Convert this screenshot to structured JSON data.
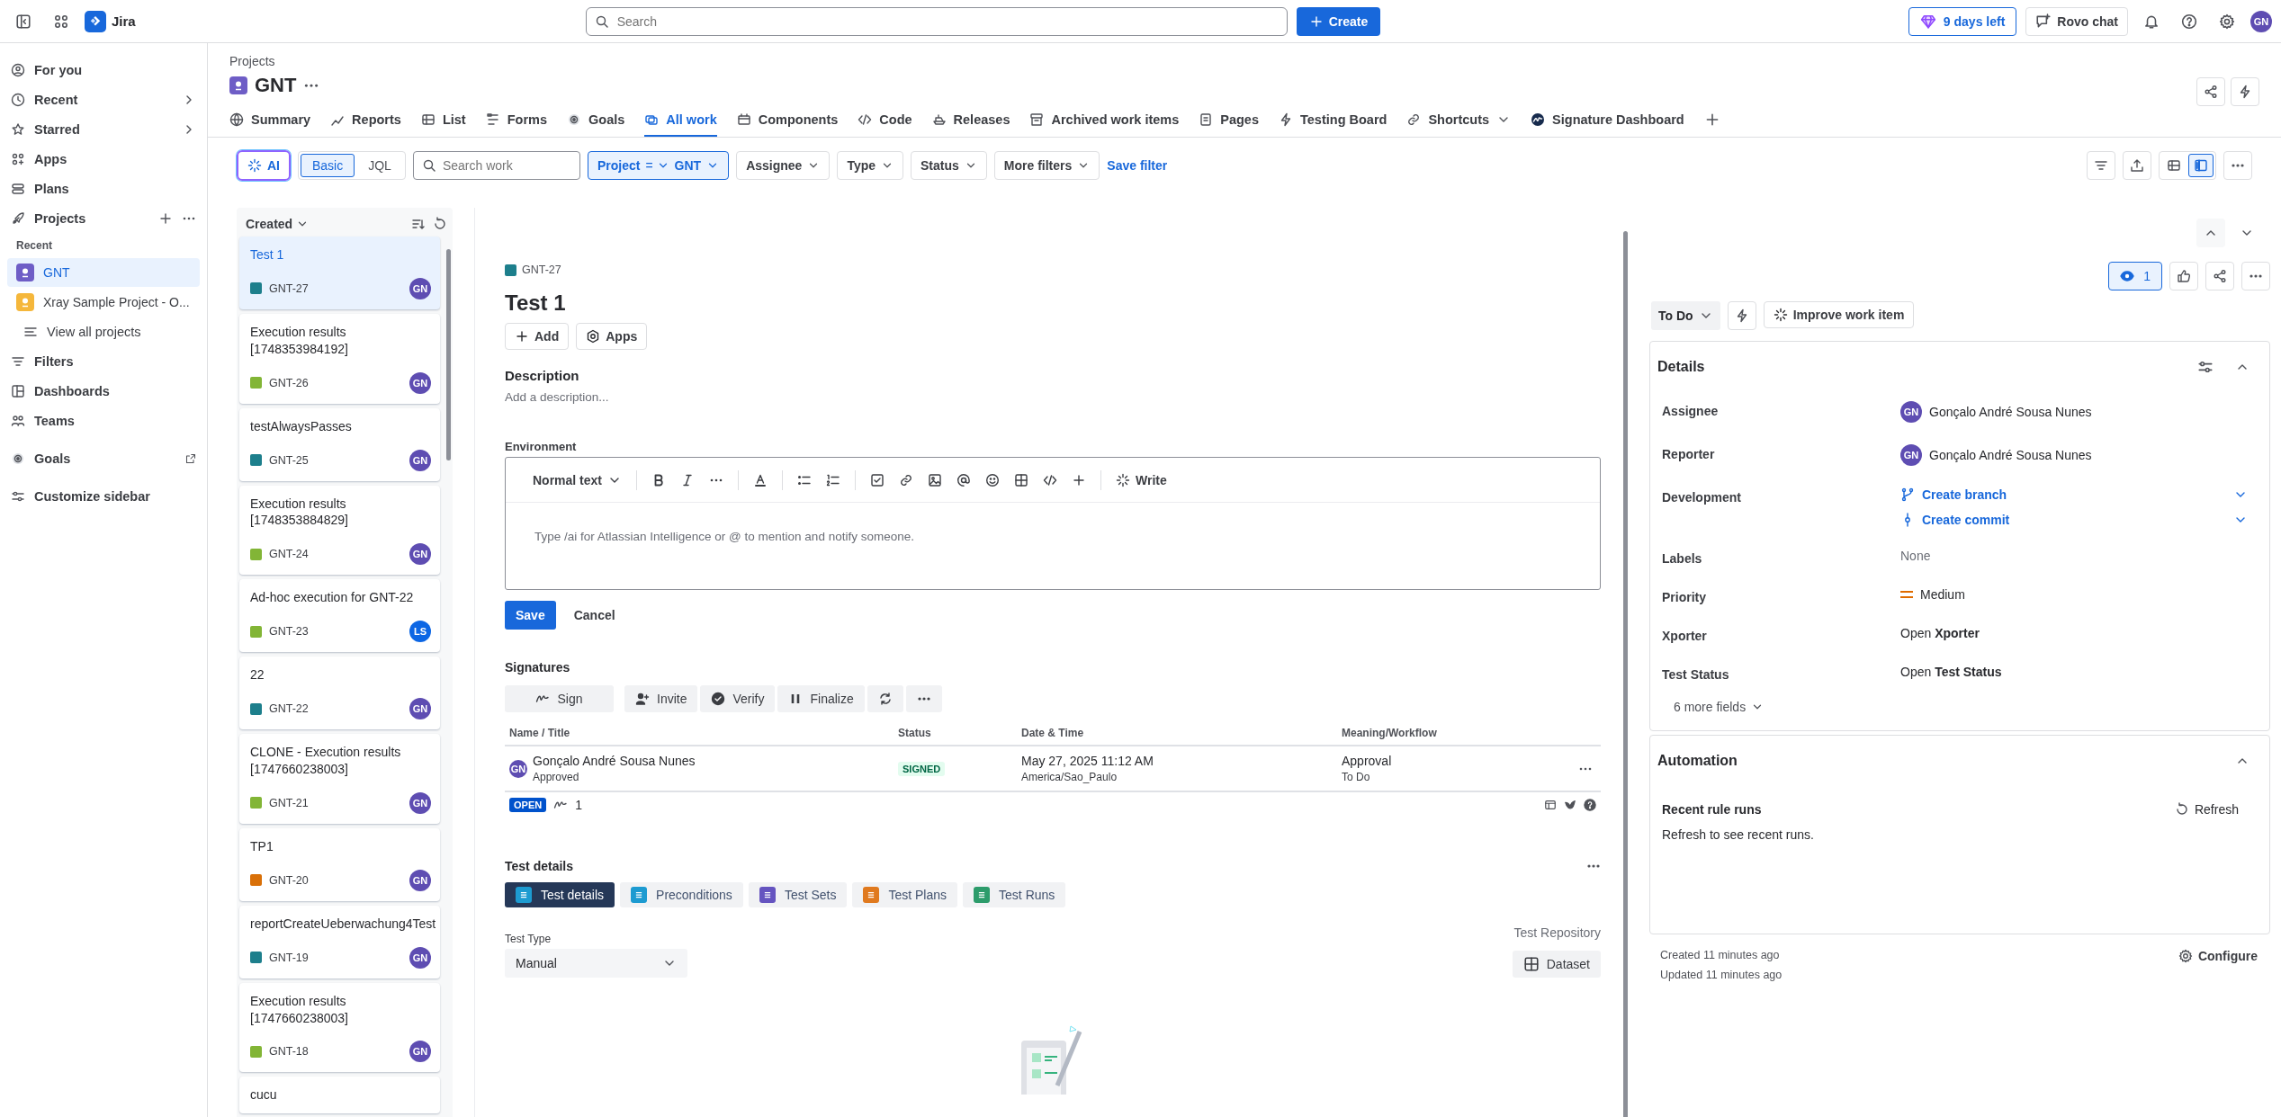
{
  "topbar": {
    "product": "Jira",
    "search": {
      "placeholder": "Search"
    },
    "create": "Create",
    "trial": "9 days left",
    "rovo": "Rovo chat",
    "avatar": "GN"
  },
  "sidebar": {
    "top_items": [
      {
        "label": "For you",
        "kind": "nav",
        "submenu": false
      },
      {
        "label": "Recent",
        "kind": "nav",
        "submenu": true
      },
      {
        "label": "Starred",
        "kind": "nav",
        "submenu": true
      },
      {
        "label": "Apps",
        "kind": "nav",
        "submenu": false
      },
      {
        "label": "Plans",
        "kind": "nav",
        "submenu": false
      },
      {
        "label": "Projects",
        "kind": "section",
        "submenu": false
      }
    ],
    "recent_label": "Recent",
    "projects": [
      {
        "label": "GNT",
        "selected": true
      },
      {
        "label": "Xray Sample Project - O...",
        "selected": false
      }
    ],
    "view_all": "View all projects",
    "bottom_items": [
      {
        "label": "Filters",
        "kind": "nav",
        "submenu": false
      },
      {
        "label": "Dashboards",
        "kind": "nav",
        "submenu": false
      },
      {
        "label": "Teams",
        "kind": "nav",
        "submenu": false
      },
      {
        "label": "Goals",
        "kind": "external",
        "submenu": false
      },
      {
        "label": "Customize sidebar",
        "kind": "nav",
        "submenu": false
      }
    ]
  },
  "page": {
    "breadcrumb": "Projects",
    "title": "GNT",
    "tabs": [
      {
        "label": "Summary",
        "selected": false,
        "dropdown": false
      },
      {
        "label": "Reports",
        "selected": false,
        "dropdown": false
      },
      {
        "label": "List",
        "selected": false,
        "dropdown": false
      },
      {
        "label": "Forms",
        "selected": false,
        "dropdown": false
      },
      {
        "label": "Goals",
        "selected": false,
        "dropdown": false
      },
      {
        "label": "All work",
        "selected": true,
        "dropdown": false
      },
      {
        "label": "Components",
        "selected": false,
        "dropdown": false
      },
      {
        "label": "Code",
        "selected": false,
        "dropdown": false
      },
      {
        "label": "Releases",
        "selected": false,
        "dropdown": false
      },
      {
        "label": "Archived work items",
        "selected": false,
        "dropdown": false
      },
      {
        "label": "Pages",
        "selected": false,
        "dropdown": false
      },
      {
        "label": "Testing Board",
        "selected": false,
        "dropdown": false
      },
      {
        "label": "Shortcuts",
        "selected": false,
        "dropdown": true
      },
      {
        "label": "Signature Dashboard",
        "selected": false,
        "dropdown": false
      }
    ]
  },
  "filters": {
    "ai": "AI",
    "modes": [
      {
        "label": "Basic",
        "selected": true
      },
      {
        "label": "JQL",
        "selected": false
      }
    ],
    "search": {
      "placeholder": "Search work"
    },
    "project": {
      "label": "Project",
      "operator": "=",
      "value": "GNT"
    },
    "dropdowns": [
      "Assignee",
      "Type",
      "Status",
      "More filters"
    ],
    "save": "Save filter",
    "view_toggle": [
      {
        "selected": false
      },
      {
        "selected": true
      }
    ]
  },
  "list": {
    "sort": "Created",
    "items": [
      {
        "title": "Test 1",
        "key": "GNT-27",
        "kind": "test",
        "avatar": "GN",
        "color": "#5e4db2",
        "selected": true
      },
      {
        "title": "Execution results [1748353984192]",
        "key": "GNT-26",
        "kind": "execution",
        "avatar": "GN",
        "color": "#5e4db2",
        "selected": false
      },
      {
        "title": "testAlwaysPasses",
        "key": "GNT-25",
        "kind": "test",
        "avatar": "GN",
        "color": "#5e4db2",
        "selected": false
      },
      {
        "title": "Execution results [1748353884829]",
        "key": "GNT-24",
        "kind": "execution",
        "avatar": "GN",
        "color": "#5e4db2",
        "selected": false
      },
      {
        "title": "Ad-hoc execution for GNT-22",
        "key": "GNT-23",
        "kind": "execution",
        "avatar": "LS",
        "color": "#0c66e4",
        "selected": false
      },
      {
        "title": "22",
        "key": "GNT-22",
        "kind": "test",
        "avatar": "GN",
        "color": "#5e4db2",
        "selected": false
      },
      {
        "title": "CLONE - Execution results [1747660238003]",
        "key": "GNT-21",
        "kind": "execution",
        "avatar": "GN",
        "color": "#5e4db2",
        "selected": false
      },
      {
        "title": "TP1",
        "key": "GNT-20",
        "kind": "plan",
        "avatar": "GN",
        "color": "#5e4db2",
        "selected": false
      },
      {
        "title": "reportCreateUeberwachung4Test",
        "key": "GNT-19",
        "kind": "test",
        "avatar": "GN",
        "color": "#5e4db2",
        "selected": false
      },
      {
        "title": "Execution results [1747660238003]",
        "key": "GNT-18",
        "kind": "execution",
        "avatar": "GN",
        "color": "#5e4db2",
        "selected": false
      },
      {
        "title": "cucu",
        "selected": false
      }
    ]
  },
  "detail": {
    "key": "GNT-27",
    "title": "Test 1",
    "actions": [
      "Add",
      "Apps"
    ],
    "description": {
      "label": "Description",
      "placeholder": "Add a description..."
    },
    "environment": {
      "label": "Environment",
      "style": "Normal text",
      "write": "Write",
      "placeholder": "Type /ai for Atlassian Intelligence or @ to mention and notify someone.",
      "save": "Save",
      "cancel": "Cancel"
    },
    "signatures": {
      "title": "Signatures",
      "buttons": [
        "Sign",
        "Invite",
        "Verify",
        "Finalize"
      ],
      "columns": [
        "Name / Title",
        "Status",
        "Date & Time",
        "Meaning/Workflow"
      ],
      "rows": [
        {
          "avatar": "GN",
          "name": "Gonçalo André Sousa Nunes",
          "subtitle": "Approved",
          "status": "SIGNED",
          "date": "May 27, 2025 11:12 AM",
          "timezone": "America/Sao_Paulo",
          "meaning": "Approval",
          "workflow": "To Do"
        }
      ],
      "state": "OPEN",
      "count": "1"
    },
    "test_details": {
      "title": "Test details",
      "tabs": [
        {
          "label": "Test details",
          "selected": true
        },
        {
          "label": "Preconditions",
          "selected": false
        },
        {
          "label": "Test Sets",
          "selected": false
        },
        {
          "label": "Test Plans",
          "selected": false
        },
        {
          "label": "Test Runs",
          "selected": false
        }
      ],
      "repository": "Test Repository",
      "test_type": {
        "label": "Test Type",
        "value": "Manual"
      },
      "dataset": "Dataset"
    }
  },
  "right": {
    "watchers": "1",
    "status": "To Do",
    "improve": "Improve work item",
    "details": {
      "title": "Details",
      "fields": [
        {
          "label": "Assignee",
          "kind": "person",
          "value": "Gonçalo André Sousa Nunes",
          "avatar": "GN"
        },
        {
          "label": "Reporter",
          "kind": "person",
          "value": "Gonçalo André Sousa Nunes",
          "avatar": "GN"
        },
        {
          "label": "Development",
          "kind": "links",
          "links": [
            "Create branch",
            "Create commit"
          ]
        },
        {
          "label": "Labels",
          "kind": "empty",
          "value": "None"
        },
        {
          "label": "Priority",
          "kind": "priority",
          "value": "Medium"
        },
        {
          "label": "Xporter",
          "kind": "rich",
          "value": "Open **Xporter**"
        },
        {
          "label": "Test Status",
          "kind": "rich",
          "value": "Open **Test Status**"
        }
      ],
      "more": "6 more fields"
    },
    "automation": {
      "title": "Automation",
      "subtitle": "Recent rule runs",
      "refresh": "Refresh",
      "message": "Refresh to see recent runs."
    },
    "created": "Created 11 minutes ago",
    "updated": "Updated 11 minutes ago",
    "configure": "Configure"
  }
}
